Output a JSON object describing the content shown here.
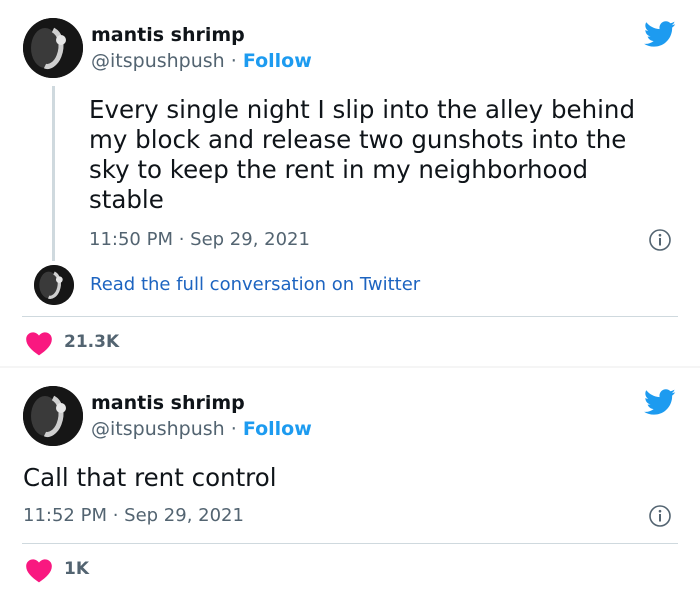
{
  "colors": {
    "link": "#1d9bf0",
    "heart": "#f91880",
    "bird": "#1d9bf0",
    "muted": "#536471"
  },
  "tweets": [
    {
      "author_name": "mantis shrimp",
      "handle": "@itspushpush",
      "separator": "·",
      "follow_label": "Follow",
      "text": "Every single night I slip into the alley behind\nmy block and release two gunshots into the\nsky to keep the rent  in my neighborhood\nstable",
      "timestamp": "11:50 PM · Sep 29, 2021",
      "read_conversation": "Read the full conversation on Twitter",
      "likes": "21.3K",
      "icons": [
        "twitter-bird-icon",
        "info-icon",
        "heart-icon"
      ]
    },
    {
      "author_name": "mantis shrimp",
      "handle": "@itspushpush",
      "separator": "·",
      "follow_label": "Follow",
      "text": "Call that rent control",
      "timestamp": "11:52 PM · Sep 29, 2021",
      "likes": "1K",
      "icons": [
        "twitter-bird-icon",
        "info-icon",
        "heart-icon"
      ]
    }
  ]
}
